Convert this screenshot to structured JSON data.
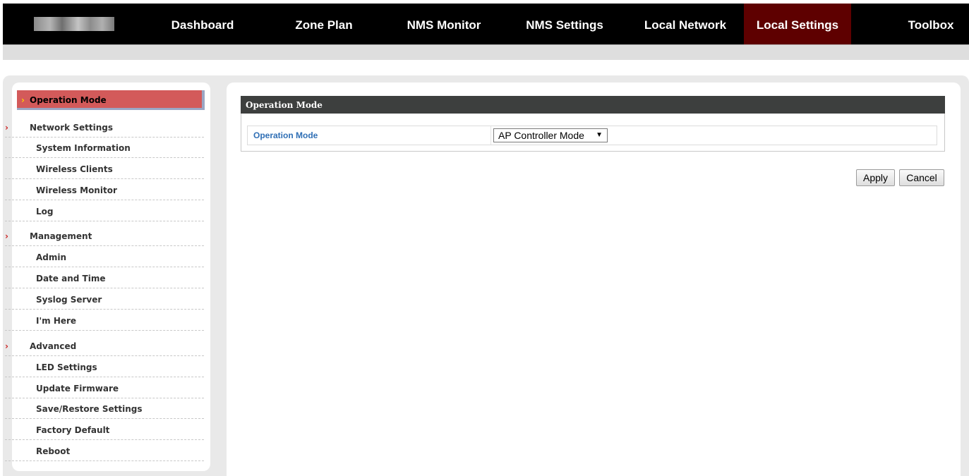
{
  "nav": {
    "items": [
      {
        "label": "Dashboard"
      },
      {
        "label": "Zone Plan"
      },
      {
        "label": "NMS Monitor"
      },
      {
        "label": "NMS Settings"
      },
      {
        "label": "Local Network"
      },
      {
        "label": "Local Settings",
        "active": true
      },
      {
        "label": "Toolbox"
      }
    ]
  },
  "sidebar": {
    "active": {
      "label": "Operation Mode"
    },
    "items": [
      {
        "label": "Network Settings",
        "type": "section"
      },
      {
        "label": "System Information",
        "type": "sub"
      },
      {
        "label": "Wireless Clients",
        "type": "sub"
      },
      {
        "label": "Wireless Monitor",
        "type": "sub"
      },
      {
        "label": "Log",
        "type": "sub"
      },
      {
        "label": "Management",
        "type": "section"
      },
      {
        "label": "Admin",
        "type": "sub"
      },
      {
        "label": "Date and Time",
        "type": "sub"
      },
      {
        "label": "Syslog Server",
        "type": "sub"
      },
      {
        "label": "I'm Here",
        "type": "sub"
      },
      {
        "label": "Advanced",
        "type": "section"
      },
      {
        "label": "LED Settings",
        "type": "sub"
      },
      {
        "label": "Update Firmware",
        "type": "sub"
      },
      {
        "label": "Save/Restore Settings",
        "type": "sub"
      },
      {
        "label": "Factory Default",
        "type": "sub"
      },
      {
        "label": "Reboot",
        "type": "sub"
      }
    ]
  },
  "panel": {
    "title": "Operation Mode",
    "field_label": "Operation Mode",
    "select_value": "AP Controller Mode"
  },
  "buttons": {
    "apply": "Apply",
    "cancel": "Cancel"
  },
  "colors": {
    "nav_active": "#5e0000",
    "sidebar_active": "#d35a5a",
    "link_blue": "#2f6fb5",
    "panel_header": "#3d3f3e"
  }
}
